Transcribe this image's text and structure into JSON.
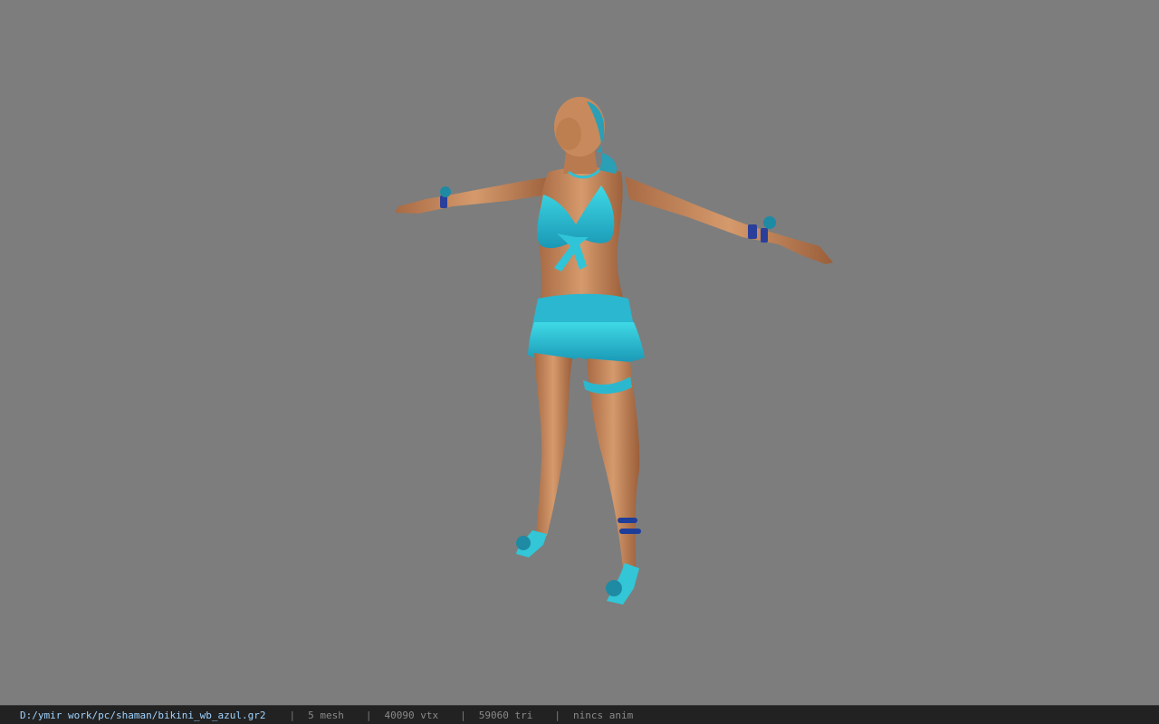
{
  "status_bar": {
    "file_path": "D:/ymir work/pc/shaman/bikini_wb_azul.gr2",
    "separator": "|",
    "mesh_count": "5 mesh",
    "vertex_count": "40090 vtx",
    "triangle_count": "59060 tri",
    "animation": "nincs anim"
  },
  "colors": {
    "viewport_background": "#7d7d7d",
    "status_bar_background": "#222222",
    "path_text": "#9fd2ff",
    "info_text": "#8a8a8a",
    "outfit_cyan": "#27c3d6",
    "outfit_dark_blue": "#2a3f9a",
    "skin": "#c98a5e"
  }
}
